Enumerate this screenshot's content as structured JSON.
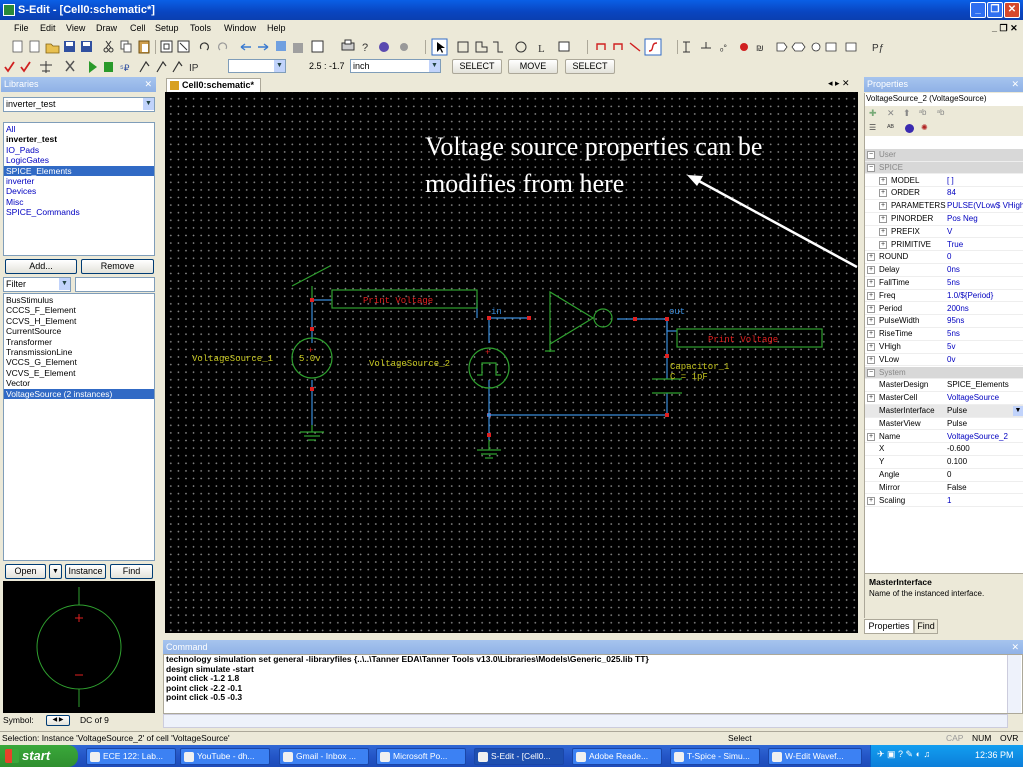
{
  "window": {
    "title": "S-Edit - [Cell0:schematic*]"
  },
  "menu": [
    "File",
    "Edit",
    "View",
    "Draw",
    "Cell",
    "Setup",
    "Tools",
    "Window",
    "Help"
  ],
  "toolbar": {
    "scale": "2.5 : -1.7",
    "unit": "inch",
    "modes": [
      "SELECT",
      "MOVE",
      "SELECT"
    ]
  },
  "libraries": {
    "header": "Libraries",
    "selected": "inverter_test",
    "items": [
      {
        "label": "All",
        "style": "link"
      },
      {
        "label": "inverter_test",
        "style": "bold"
      },
      {
        "label": "IO_Pads",
        "style": "link"
      },
      {
        "label": "LogicGates",
        "style": "link"
      },
      {
        "label": "SPICE_Elements",
        "style": "sel"
      },
      {
        "label": "inverter",
        "style": "link"
      },
      {
        "label": "Devices",
        "style": "link"
      },
      {
        "label": "Misc",
        "style": "link"
      },
      {
        "label": "SPICE_Commands",
        "style": "link"
      }
    ],
    "add_label": "Add...",
    "remove_label": "Remove",
    "filter_label": "Filter",
    "cells": [
      "BusStimulus",
      "CCCS_F_Element",
      "CCVS_H_Element",
      "CurrentSource",
      "Transformer",
      "TransmissionLine",
      "VCCS_G_Element",
      "VCVS_E_Element",
      "Vector",
      "VoltageSource (2 instances)"
    ],
    "selected_cell": "VoltageSource (2 instances)",
    "open_label": "Open",
    "instance_label": "Instance",
    "find_label": "Find",
    "symbol_label": "Symbol:",
    "symbol_page": "DC of 9"
  },
  "editor": {
    "tab": "Cell0:schematic*",
    "annotation": "Voltage source properties can be modifies from here",
    "labels": {
      "print1": "Print Voltage",
      "print2": "Print Voltage",
      "in": "in",
      "out": "out",
      "vs1": "VoltageSource_1",
      "vs1_value": "5.0v",
      "vs2": "VoltageSource_2",
      "cap": "Capacitor_1",
      "cap_value": "C = 1pF"
    }
  },
  "properties": {
    "header": "Properties",
    "object": "VoltageSource_2 (VoltageSource)",
    "rows": [
      {
        "name": "User",
        "value": "",
        "kind": "cat"
      },
      {
        "name": "SPICE",
        "value": "",
        "kind": "cat"
      },
      {
        "name": "MODEL",
        "value": "[ ]",
        "kind": "sub"
      },
      {
        "name": "ORDER",
        "value": "84",
        "kind": "sub"
      },
      {
        "name": "PARAMETERS",
        "value": "PULSE(VLow$ VHigh",
        "kind": "sub"
      },
      {
        "name": "PINORDER",
        "value": "Pos Neg",
        "kind": "sub"
      },
      {
        "name": "PREFIX",
        "value": "V",
        "kind": "sub"
      },
      {
        "name": "PRIMITIVE",
        "value": "True",
        "kind": "sub"
      },
      {
        "name": "ROUND",
        "value": "0",
        "kind": "row"
      },
      {
        "name": "Delay",
        "value": "0ns",
        "kind": "row"
      },
      {
        "name": "FallTime",
        "value": "5ns",
        "kind": "row"
      },
      {
        "name": "Freq",
        "value": "1.0/${Period}",
        "kind": "row"
      },
      {
        "name": "Period",
        "value": "200ns",
        "kind": "row"
      },
      {
        "name": "PulseWidth",
        "value": "95ns",
        "kind": "row"
      },
      {
        "name": "RiseTime",
        "value": "5ns",
        "kind": "row"
      },
      {
        "name": "VHigh",
        "value": "5v",
        "kind": "row"
      },
      {
        "name": "VLow",
        "value": "0v",
        "kind": "row"
      },
      {
        "name": "System",
        "value": "",
        "kind": "cat"
      },
      {
        "name": "MasterDesign",
        "value": "SPICE_Elements",
        "kind": "plain"
      },
      {
        "name": "MasterCell",
        "value": "VoltageSource",
        "kind": "row"
      },
      {
        "name": "MasterInterface",
        "value": "Pulse",
        "kind": "selected"
      },
      {
        "name": "MasterView",
        "value": "Pulse",
        "kind": "plain"
      },
      {
        "name": "Name",
        "value": "VoltageSource_2",
        "kind": "row"
      },
      {
        "name": "X",
        "value": "-0.600",
        "kind": "plain"
      },
      {
        "name": "Y",
        "value": "0.100",
        "kind": "plain"
      },
      {
        "name": "Angle",
        "value": "0",
        "kind": "plain"
      },
      {
        "name": "Mirror",
        "value": "False",
        "kind": "plain"
      },
      {
        "name": "Scaling",
        "value": "1",
        "kind": "row"
      }
    ],
    "desc_title": "MasterInterface",
    "desc_text": "Name of the instanced interface.",
    "tabs": [
      "Properties",
      "Find"
    ]
  },
  "command": {
    "header": "Command",
    "lines": [
      "technology simulation set general -libraryfiles {..\\..\\Tanner EDA\\Tanner Tools v13.0\\Libraries\\Models\\Generic_025.lib TT}",
      "design simulate -start",
      "point click -1.2 1.8",
      "point click -2.2 -0.1",
      "point click -0.5 -0.3"
    ]
  },
  "status": {
    "text": "Selection: Instance 'VoltageSource_2' of cell 'VoltageSource'",
    "mode": "Select",
    "caps": "CAP",
    "num": "NUM",
    "ovr": "OVR"
  },
  "taskbar": {
    "start": "start",
    "tasks": [
      "ECE 122: Lab...",
      "YouTube - dh...",
      "Gmail - Inbox ...",
      "Microsoft Po...",
      "S-Edit - [Cell0...",
      "Adobe Reade...",
      "T-Spice - Simu...",
      "W-Edit Wavef..."
    ],
    "clock": "12:36 PM"
  },
  "colors": {
    "wire": "#3a8bd8",
    "node": "#e02020",
    "component": "#2fa02f",
    "label": "#c8c820",
    "print": "#e02020",
    "annotation": "#ffffff"
  }
}
